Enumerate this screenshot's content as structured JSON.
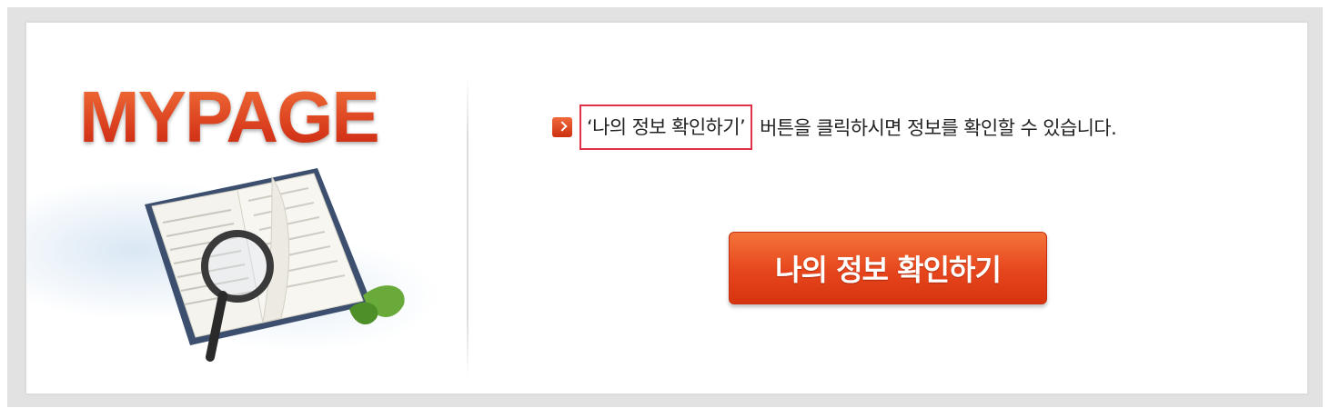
{
  "hero": {
    "title": "MYPAGE",
    "illustration_icon": "open-book-with-magnifier-icon"
  },
  "notice": {
    "icon": "red-arrow-bullet-icon",
    "highlighted_text": "‘나의 정보 확인하기’",
    "rest_text": "버튼을 클릭하시면 정보를 확인할 수 있습니다."
  },
  "button": {
    "label": "나의 정보 확인하기"
  },
  "colors": {
    "accent": "#e6451c",
    "highlight_border": "#e0304a",
    "frame": "#e2e2e2"
  }
}
